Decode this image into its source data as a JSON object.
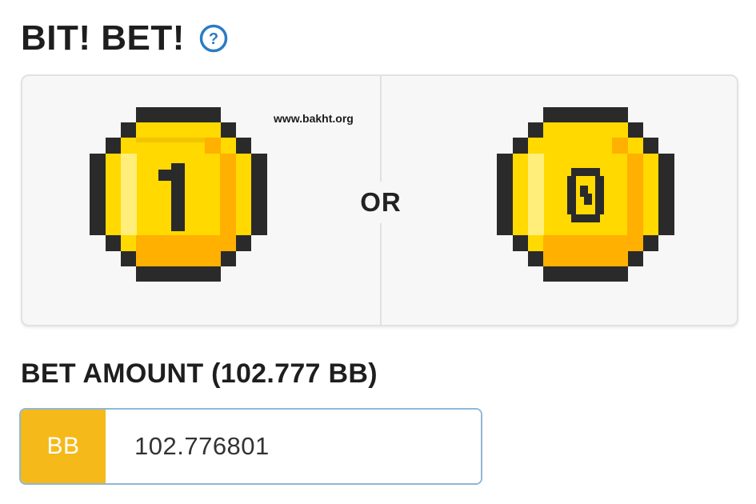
{
  "header": {
    "title": "BIT! BET!",
    "help_icon": "question-circle-icon",
    "help_color": "#2a7cc4"
  },
  "coin_choices": {
    "left": {
      "icon": "pixel-coin-one-icon",
      "glyph": "1"
    },
    "separator": "OR",
    "right": {
      "icon": "pixel-coin-zero-icon",
      "glyph": "0"
    },
    "watermark": "www.bakht.org"
  },
  "bet": {
    "label": "BET AMOUNT (102.777 BB)",
    "currency": "BB",
    "value": "102.776801",
    "accent_color": "#f5b919"
  },
  "colors": {
    "coin_outline": "#2a2a2a",
    "coin_face": "#ffd900",
    "coin_shade": "#ffb000"
  }
}
